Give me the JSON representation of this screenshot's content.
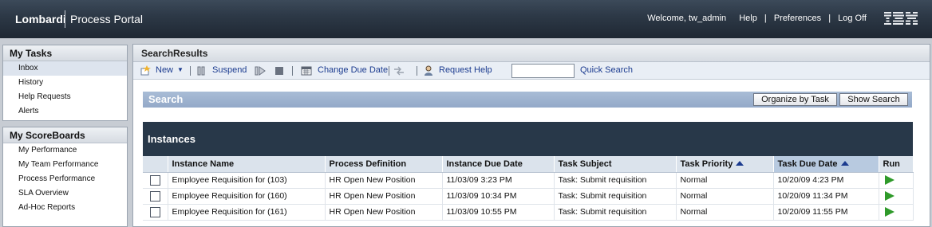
{
  "header": {
    "brand": "Lombardi",
    "product": "Process Portal",
    "welcome": "Welcome, tw_admin",
    "links": [
      "Help",
      "Preferences",
      "Log Off"
    ],
    "logo": "IBM."
  },
  "sidebar": {
    "tasks": {
      "title": "My Tasks",
      "items": [
        "Inbox",
        "History",
        "Help Requests",
        "Alerts"
      ],
      "active": "Inbox"
    },
    "scoreboards": {
      "title": "My ScoreBoards",
      "items": [
        "My Performance",
        "My Team Performance",
        "Process Performance",
        "SLA Overview",
        "Ad-Hoc Reports"
      ]
    }
  },
  "main": {
    "title": "SearchResults",
    "toolbar": {
      "new_label": "New",
      "suspend_label": "Suspend",
      "change_due_label": "Change Due Date",
      "request_help_label": "Request Help",
      "search_value": "",
      "quick_search_label": "Quick Search"
    },
    "search": {
      "title": "Search",
      "organize_label": "Organize by Task",
      "show_search_label": "Show Search"
    },
    "instances": {
      "title": "Instances",
      "columns": [
        "Instance Name",
        "Process Definition",
        "Instance Due Date",
        "Task Subject",
        "Task Priority",
        "Task Due Date",
        "Run"
      ],
      "rows": [
        [
          "Employee Requisition for (103)",
          "HR Open New Position",
          "11/03/09 3:23 PM",
          "Task: Submit requisition",
          "Normal",
          "10/20/09 4:23 PM"
        ],
        [
          "Employee Requisition for (160)",
          "HR Open New Position",
          "11/03/09 10:34 PM",
          "Task: Submit requisition",
          "Normal",
          "10/20/09 11:34 PM"
        ],
        [
          "Employee Requisition for (161)",
          "HR Open New Position",
          "11/03/09 10:55 PM",
          "Task: Submit requisition",
          "Normal",
          "10/20/09 11:55 PM"
        ]
      ]
    }
  },
  "colors": {
    "banner": "#2d3947",
    "instances_header": "#283849",
    "search_bar": "#a0b4cf",
    "link": "#1b3b8f",
    "run_icon": "#2f9a2a"
  }
}
